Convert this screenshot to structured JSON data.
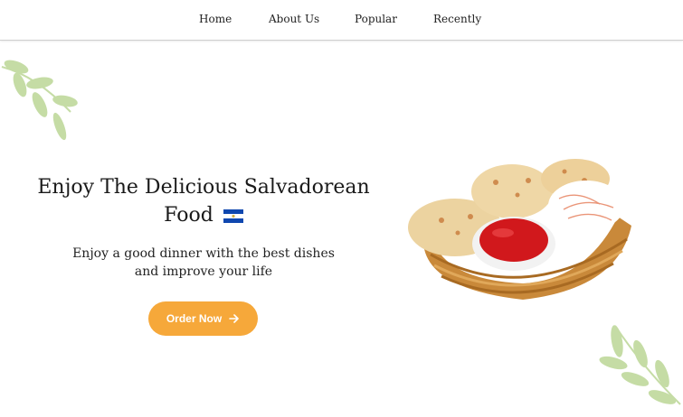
{
  "nav": {
    "items": [
      {
        "label": "Home"
      },
      {
        "label": "About Us"
      },
      {
        "label": "Popular"
      },
      {
        "label": "Recently"
      }
    ]
  },
  "hero": {
    "title_line1": "Enjoy The Delicious Salvadorean",
    "title_line2": "Food",
    "subtitle_line1": "Enjoy a good dinner with the best dishes",
    "subtitle_line2": "and improve your life",
    "cta_label": "Order Now",
    "flag_icon": "el-salvador-flag-icon",
    "cta_icon": "arrow-right-icon"
  },
  "colors": {
    "accent": "#f6a83a",
    "leaf": "#c5dca5",
    "flag_blue": "#0f47af",
    "text": "#1a1a1a"
  }
}
